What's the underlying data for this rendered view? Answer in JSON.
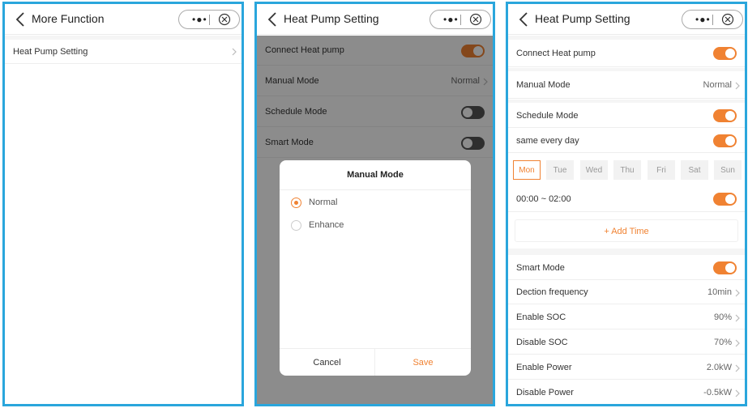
{
  "colors": {
    "accent": "#f08232",
    "frame": "#2aa6dc",
    "toggle_off": "#555555"
  },
  "screen1": {
    "title": "More Function",
    "items": [
      {
        "label": "Heat Pump Setting"
      }
    ]
  },
  "screen2": {
    "title": "Heat Pump Setting",
    "rows": {
      "connect": {
        "label": "Connect Heat pump",
        "toggle": true
      },
      "manual": {
        "label": "Manual Mode",
        "value": "Normal"
      },
      "schedule": {
        "label": "Schedule Mode",
        "toggle": false
      },
      "smart": {
        "label": "Smart Mode",
        "toggle": false
      }
    },
    "modal": {
      "title": "Manual Mode",
      "options": [
        {
          "label": "Normal",
          "selected": true
        },
        {
          "label": "Enhance",
          "selected": false
        }
      ],
      "cancel": "Cancel",
      "save": "Save"
    }
  },
  "screen3": {
    "title": "Heat Pump Setting",
    "connect": {
      "label": "Connect Heat pump",
      "toggle": true
    },
    "manual": {
      "label": "Manual Mode",
      "value": "Normal"
    },
    "schedule": {
      "label": "Schedule Mode",
      "toggle": true
    },
    "same_every_day": {
      "label": "same every day",
      "toggle": true
    },
    "days": [
      {
        "label": "Mon",
        "active": true
      },
      {
        "label": "Tue",
        "active": false
      },
      {
        "label": "Wed",
        "active": false
      },
      {
        "label": "Thu",
        "active": false
      },
      {
        "label": "Fri",
        "active": false
      },
      {
        "label": "Sat",
        "active": false
      },
      {
        "label": "Sun",
        "active": false
      }
    ],
    "time_slot": {
      "label": "00:00 ~ 02:00",
      "toggle": true
    },
    "add_time": "+ Add Time",
    "smart": {
      "label": "Smart Mode",
      "toggle": true
    },
    "detection_frequency": {
      "label": "Dection frequency",
      "value": "10min"
    },
    "enable_soc": {
      "label": "Enable SOC",
      "value": "90%"
    },
    "disable_soc": {
      "label": "Disable SOC",
      "value": "70%"
    },
    "enable_power": {
      "label": "Enable Power",
      "value": "2.0kW"
    },
    "disable_power": {
      "label": "Disable Power",
      "value": "-0.5kW"
    }
  }
}
